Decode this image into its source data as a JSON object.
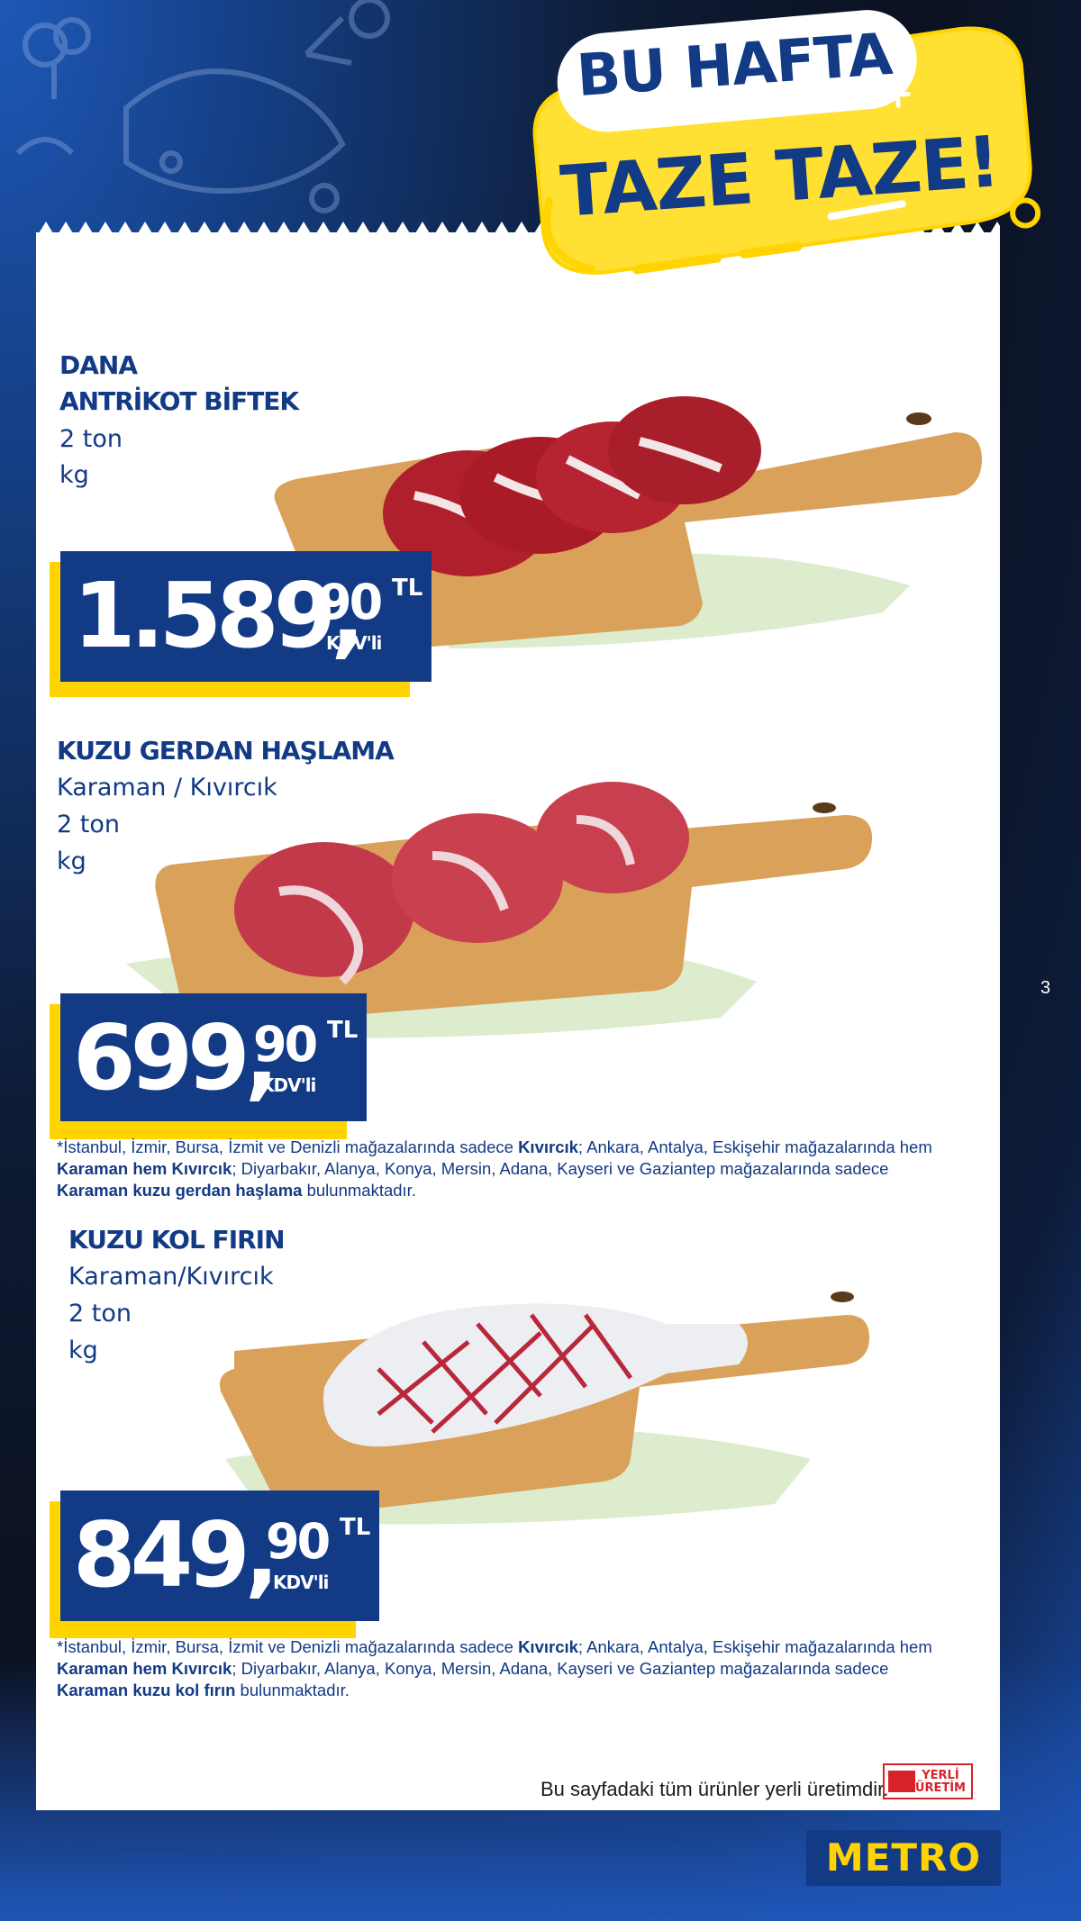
{
  "header": {
    "line1": "BU HAFTA",
    "line2": "TAZE TAZE!"
  },
  "products": [
    {
      "name_lines": [
        "DANA",
        "ANTRİKOT BİFTEK"
      ],
      "detail_lines": [
        "2 ton",
        "kg"
      ],
      "price": {
        "integer": "1.589,",
        "decimal": "90",
        "currency": "TL",
        "tax": "KDV'li"
      }
    },
    {
      "name_lines": [
        "KUZU GERDAN HAŞLAMA"
      ],
      "detail_lines": [
        "Karaman / Kıvırcık",
        "2 ton",
        "kg"
      ],
      "price": {
        "integer": "699,",
        "decimal": "90",
        "currency": "TL",
        "tax": "KDV'li"
      },
      "note": {
        "p1": "*İstanbul, İzmir, Bursa, İzmit ve Denizli mağazalarında sadece ",
        "b1": "Kıvırcık",
        "p2": "; Ankara, Antalya, Eskişehir mağazalarında hem",
        "b2": "Karaman hem Kıvırcık",
        "p3": "; Diyarbakır, Alanya, Konya, Mersin, Adana, Kayseri ve Gaziantep mağazalarında sadece",
        "b3": "Karaman kuzu gerdan haşlama",
        "p4": " bulunmaktadır."
      }
    },
    {
      "name_lines": [
        "KUZU KOL FIRIN"
      ],
      "detail_lines": [
        "Karaman/Kıvırcık",
        "2 ton",
        "kg"
      ],
      "price": {
        "integer": "849,",
        "decimal": "90",
        "currency": "TL",
        "tax": "KDV'li"
      },
      "note": {
        "p1": "*İstanbul, İzmir, Bursa, İzmit ve Denizli mağazalarında sadece ",
        "b1": "Kıvırcık",
        "p2": "; Ankara, Antalya, Eskişehir mağazalarında hem",
        "b2": "Karaman hem Kıvırcık",
        "p3": "; Diyarbakır, Alanya, Konya, Mersin, Adana, Kayseri ve Gaziantep mağazalarında sadece",
        "b3": "Karaman kuzu kol fırın",
        "p4": " bulunmaktadır."
      }
    }
  ],
  "page_number": "3",
  "footer": {
    "text": "Bu sayfadaki tüm ürünler yerli üretimdir.",
    "badge_line1": "YERLİ",
    "badge_line2": "ÜRETİM"
  },
  "brand": "METRO",
  "colors": {
    "navy": "#123a85",
    "yellow": "#ffd400",
    "red": "#d6232a"
  },
  "icons": [
    "fish-doodle-icon",
    "broccoli-doodle-icon",
    "cutting-board-icon",
    "yerli-uretim-icon"
  ]
}
